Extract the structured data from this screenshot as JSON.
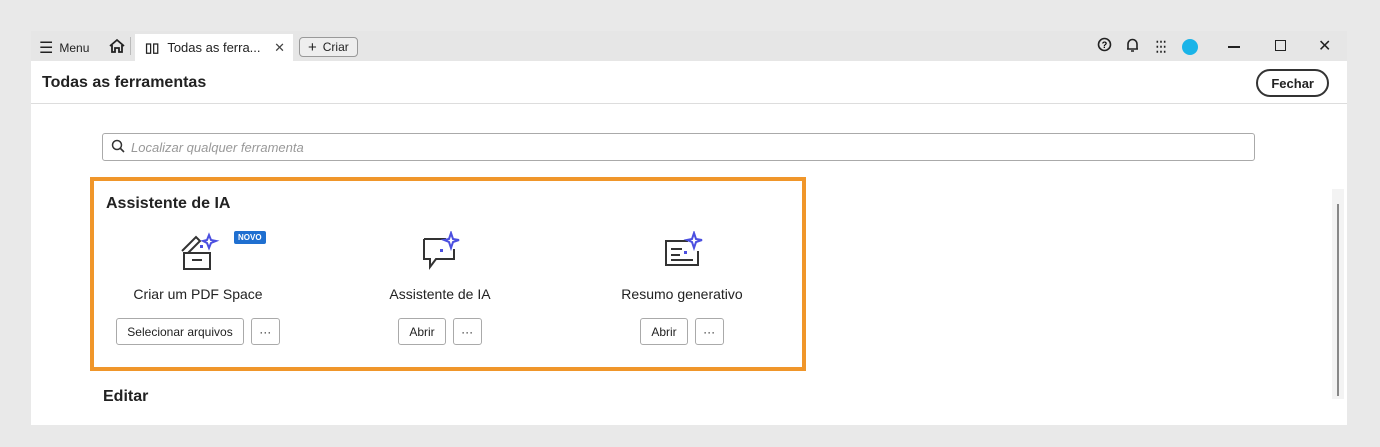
{
  "titlebar": {
    "menu_label": "Menu",
    "tab_label": "Todas as ferra...",
    "create_label": "Criar"
  },
  "header": {
    "title": "Todas as ferramentas",
    "close_label": "Fechar"
  },
  "search": {
    "placeholder": "Localizar qualquer ferramenta"
  },
  "section": {
    "title": "Assistente de IA",
    "cards": [
      {
        "label": "Criar um PDF Space",
        "badge": "NOVO",
        "button": "Selecionar arquivos",
        "more": "···"
      },
      {
        "label": "Assistente de IA",
        "button": "Abrir",
        "more": "···"
      },
      {
        "label": "Resumo generativo",
        "button": "Abrir",
        "more": "···"
      }
    ]
  },
  "next_section": {
    "title": "Editar"
  },
  "colors": {
    "highlight": "#f0962a",
    "badge": "#1f6fd0",
    "sparkle": "#4b4fe0"
  }
}
